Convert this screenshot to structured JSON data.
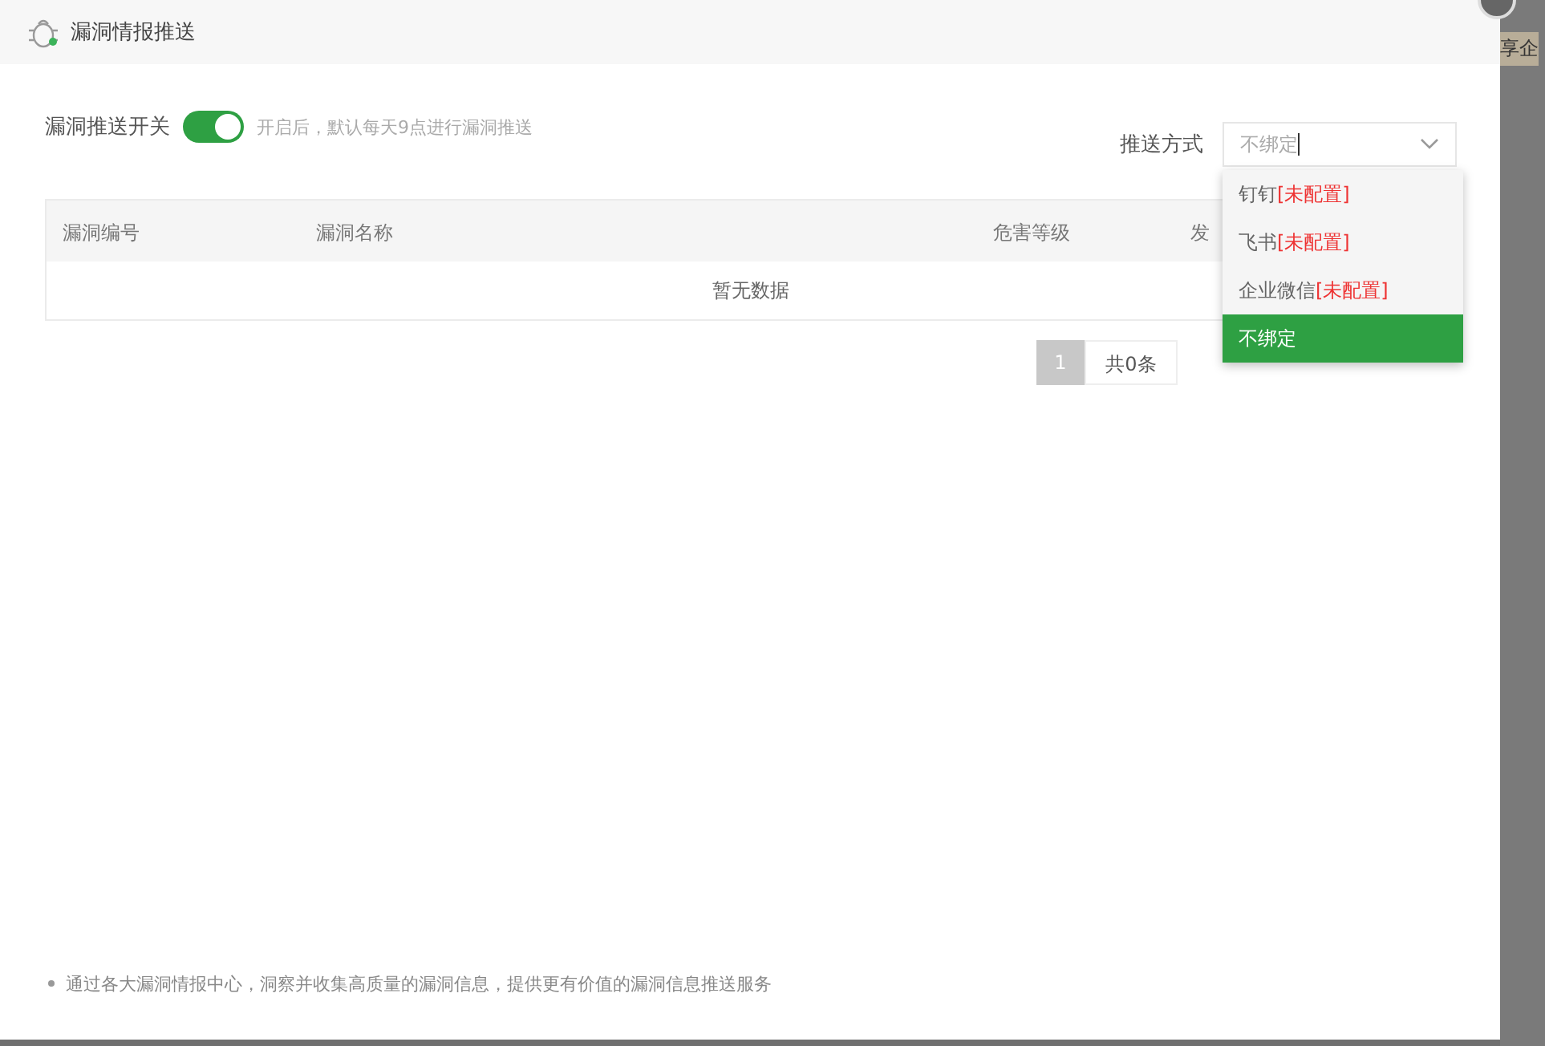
{
  "dialog": {
    "title": "漏洞情报推送"
  },
  "push_switch": {
    "label": "漏洞推送开关",
    "on": true,
    "hint": "开启后，默认每天9点进行漏洞推送"
  },
  "push_method": {
    "label": "推送方式",
    "value": "不绑定",
    "expanded": true,
    "options": [
      {
        "label": "钉钉",
        "status": "[未配置]",
        "selected": false
      },
      {
        "label": "飞书",
        "status": "[未配置]",
        "selected": false
      },
      {
        "label": "企业微信",
        "status": "[未配置]",
        "selected": false
      },
      {
        "label": "不绑定",
        "selected": true
      }
    ]
  },
  "table": {
    "columns": [
      "漏洞编号",
      "漏洞名称",
      "危害等级",
      "发"
    ],
    "empty_text": "暂无数据"
  },
  "pagination": {
    "pages": [
      {
        "label": "1",
        "selected": true
      }
    ],
    "total": "共0条"
  },
  "note": "通过各大漏洞情报中心，洞察并收集高质量的漏洞信息，提供更有价值的漏洞信息推送服务",
  "background_text": "享企"
}
